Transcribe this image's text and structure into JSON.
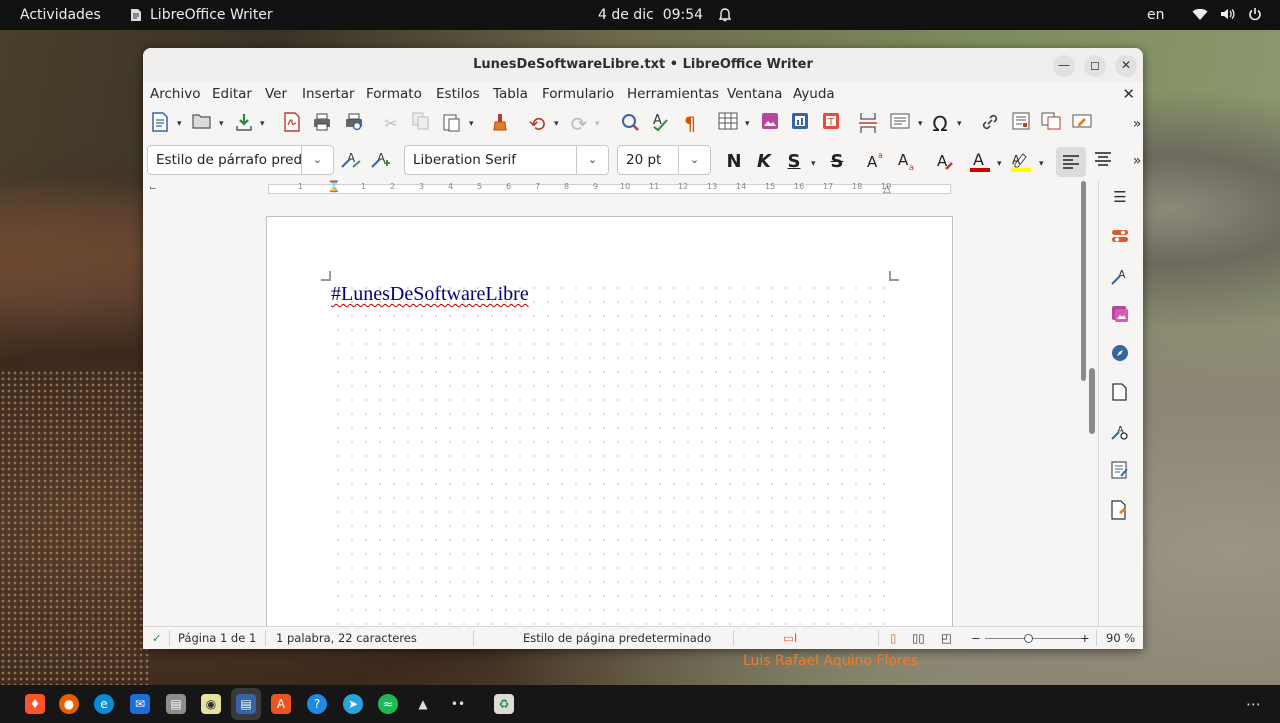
{
  "topbar": {
    "activities": "Actividades",
    "app_name": "LibreOffice Writer",
    "date": "4 de dic",
    "time": "09:54",
    "language": "en"
  },
  "window": {
    "title": "LunesDeSoftwareLibre.txt • LibreOffice Writer"
  },
  "menu": {
    "items": [
      "Archivo",
      "Editar",
      "Ver",
      "Insertar",
      "Formato",
      "Estilos",
      "Tabla",
      "Formulario",
      "Herramientas",
      "Ventana",
      "Ayuda"
    ]
  },
  "formatting": {
    "paragraph_style": "Estilo de párrafo pred",
    "font_name": "Liberation Serif",
    "font_size": "20 pt",
    "bold": "N",
    "italic": "K",
    "underline": "S",
    "strike": "S"
  },
  "ruler": {
    "numbers": [
      "1",
      "1",
      "2",
      "3",
      "4",
      "5",
      "6",
      "7",
      "8",
      "9",
      "10",
      "11",
      "12",
      "13",
      "14",
      "15",
      "16",
      "17",
      "18",
      "19"
    ]
  },
  "document": {
    "text": "#LunesDeSoftwareLibre"
  },
  "status": {
    "page": "Página 1 de 1",
    "words": "1 palabra, 22 caracteres",
    "page_style": "Estilo de página predeterminado",
    "zoom": "90 %",
    "zoom_level": 0.9
  },
  "signature": "Luis Rafael Aquino Flores",
  "colors": {
    "font_color": "#cc0000",
    "highlight_color": "#ffff00",
    "text_color": "#000080"
  }
}
